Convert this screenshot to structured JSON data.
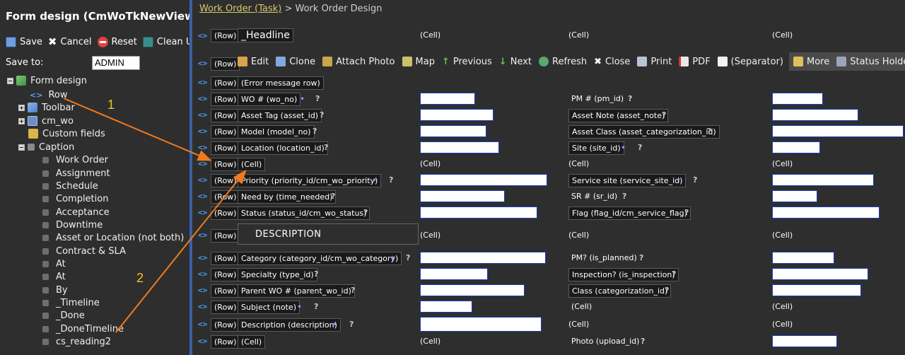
{
  "left": {
    "title": "Form design (CmWoTkNewViewRead)",
    "toolbar": {
      "save": "Save",
      "cancel": "Cancel",
      "reset": "Reset",
      "clean": "Clean U"
    },
    "save_to_label": "Save to:",
    "save_to_value": "ADMIN",
    "tree": {
      "form_design": "Form design",
      "row": "Row",
      "toolbar": "Toolbar",
      "cm_wo": "cm_wo",
      "custom_fields": "Custom fields",
      "caption": "Caption",
      "caption_children": [
        "Work Order",
        "Assignment",
        "Schedule",
        "Completion",
        "Acceptance",
        "Downtime",
        "Asset or Location (not both)",
        "Contract & SLA",
        "At",
        "At",
        "By",
        "_Timeline",
        "_Done",
        "_DoneTimeline",
        "cs_reading2"
      ]
    }
  },
  "breadcrumb": {
    "link": "Work Order (Task)",
    "separator": ">",
    "current": "Work Order Design"
  },
  "labels": {
    "row": "(Row)",
    "cell": "(Cell)",
    "headline": "_Headline",
    "description": "DESCRIPTION",
    "error_row": "(Error message row)",
    "q": "?",
    "dot": "•",
    "code": "<>"
  },
  "toolbar_row": [
    "Edit",
    "Clone",
    "Attach Photo",
    "Map",
    "Previous",
    "Next",
    "Refresh",
    "Close",
    "Print",
    "PDF",
    "(Separator)"
  ],
  "toolbar_more": [
    "More",
    "Status Holder"
  ],
  "fields": {
    "wo_no": "WO # (wo_no)",
    "pm_id": "PM # (pm_id)",
    "asset_id": "Asset Tag (asset_id)",
    "asset_note": "Asset Note (asset_note)",
    "model_no": "Model (model_no)",
    "asset_class": "Asset Class (asset_categorization_id)",
    "location_id": "Location (location_id)",
    "site_id": "Site (site_id)",
    "priority": "Priority (priority_id/cm_wo_priority)",
    "service_site": "Service site (service_site_id)",
    "time_needed": "Need by (time_needed)",
    "sr_id": "SR # (sr_id)",
    "status": "Status (status_id/cm_wo_status)",
    "flag": "Flag (flag_id/cm_service_flag)",
    "category": "Category (category_id/cm_wo_category)",
    "is_planned": "PM? (is_planned)",
    "type_id": "Specialty (type_id)",
    "is_inspection": "Inspection? (is_inspection)",
    "parent_wo": "Parent WO # (parent_wo_id)",
    "categorization_id": "Class (categorization_id)",
    "note": "Subject (note)",
    "description": "Description (description)",
    "upload_id": "Photo (upload_id)"
  },
  "annotations": [
    "1",
    "2"
  ],
  "colors": {
    "background": "#2e2e2e",
    "accent_blue": "#3c5fa8",
    "link_yellow": "#d6c86a",
    "annotation_orange": "#f07a1e",
    "annotation_number": "#f2c230",
    "required_dot": "#c07cff"
  }
}
